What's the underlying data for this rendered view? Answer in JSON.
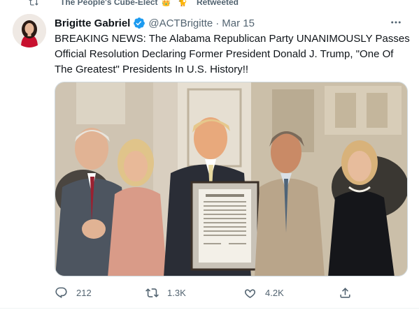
{
  "retweet_context": {
    "user_name": "The People's Cube-Elect",
    "emoji_1": "👑",
    "emoji_2": "🐈",
    "action_label": "Retweeted",
    "icon": "retweet-icon"
  },
  "tweet": {
    "author_name": "Brigitte Gabriel",
    "verified_icon": "verified-badge-icon",
    "handle": "@ACTBrigitte",
    "separator": "·",
    "date": "Mar 15",
    "text": "BREAKING NEWS: The Alabama Republican Party UNANIMOUSLY Passes Official Resolution Declaring Former President Donald J. Trump, \"One Of The Greatest\" Presidents In U.S. History!!",
    "more_icon": "more-options-icon"
  },
  "actions": {
    "reply": {
      "icon": "reply-icon",
      "count": "212"
    },
    "retweet": {
      "icon": "retweet-icon",
      "count": "1.3K"
    },
    "like": {
      "icon": "heart-icon",
      "count": "4.2K"
    },
    "share": {
      "icon": "share-icon",
      "count": ""
    }
  },
  "colors": {
    "text_primary": "#0f1419",
    "text_secondary": "#536471",
    "verified_blue": "#1d9bf0",
    "border": "#cfd9de"
  }
}
